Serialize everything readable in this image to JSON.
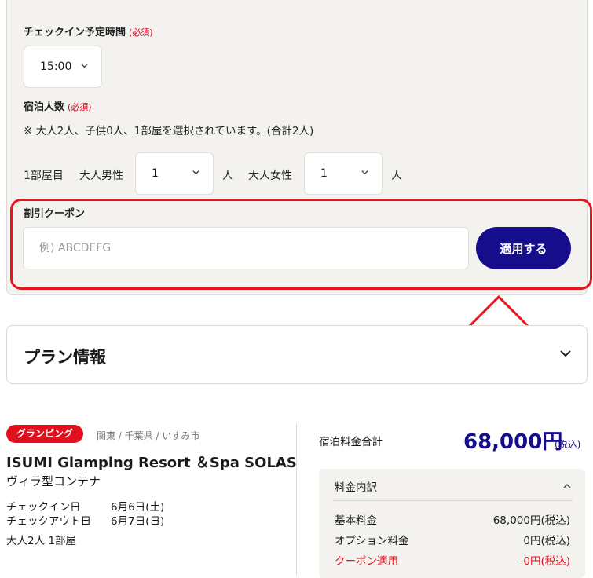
{
  "checkin_time": {
    "label": "チェックイン予定時間",
    "required": "(必須)",
    "value": "15:00"
  },
  "guests": {
    "label": "宿泊人数",
    "required": "(必須)",
    "note": "※ 大人2人、子供0人、1部屋を選択されています。(合計2人)",
    "room_label": "1部屋目",
    "male_label": "大人男性",
    "male_value": "1",
    "female_label": "大人女性",
    "female_value": "1",
    "unit": "人"
  },
  "coupon": {
    "label": "割引クーポン",
    "placeholder": "例) ABCDEFG",
    "apply_label": "適用する"
  },
  "plan": {
    "title": "プラン情報"
  },
  "facility": {
    "tag": "グランピング",
    "location": "関東 / 千葉県 / いすみ市",
    "name": "ISUMI Glamping Resort ＆Spa SOLAS",
    "room_type": "ヴィラ型コンテナ",
    "checkin_label": "チェックイン日",
    "checkin_date": "6月6日(土)",
    "checkout_label": "チェックアウト日",
    "checkout_date": "6月7日(日)",
    "guests_summary": "大人2人 1部屋"
  },
  "pricing": {
    "total_label": "宿泊料金合計",
    "total_value": "68,000円",
    "total_tax": "(税込)",
    "breakdown_title": "料金内訳",
    "rows": [
      {
        "label": "基本料金",
        "value": "68,000円(税込)"
      },
      {
        "label": "オプション料金",
        "value": "0円(税込)"
      },
      {
        "label": "クーポン適用",
        "value": "-0円(税込)"
      }
    ]
  },
  "colors": {
    "accent": "#160d8c",
    "highlight": "#e8141e",
    "tag": "#e20f1c"
  }
}
